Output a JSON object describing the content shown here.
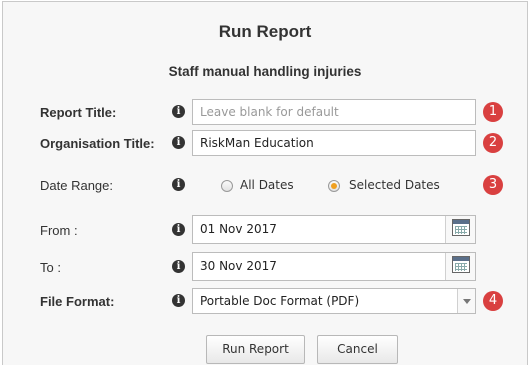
{
  "dialog": {
    "title": "Run Report",
    "subtitle": "Staff manual handling injuries"
  },
  "fields": {
    "report_title": {
      "label": "Report Title:",
      "placeholder": "Leave blank for default",
      "value": "",
      "step": "1"
    },
    "organisation_title": {
      "label": "Organisation Title:",
      "value": "RiskMan Education",
      "step": "2"
    },
    "date_range": {
      "label": "Date Range:",
      "options": [
        "All Dates",
        "Selected Dates"
      ],
      "selected": "Selected Dates",
      "step": "3"
    },
    "from": {
      "label": "From :",
      "value": "01 Nov 2017"
    },
    "to": {
      "label": "To :",
      "value": "30 Nov 2017"
    },
    "file_format": {
      "label": "File Format:",
      "value": "Portable Doc Format (PDF)",
      "step": "4"
    }
  },
  "info_icon": "i",
  "buttons": {
    "run": "Run Report",
    "cancel": "Cancel"
  },
  "colors": {
    "step_badge": "#d94040",
    "radio_selected": "#f0a020"
  }
}
